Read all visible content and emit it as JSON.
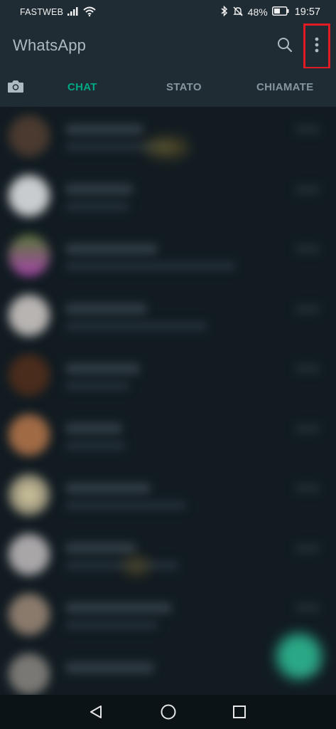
{
  "status_bar": {
    "carrier": "FASTWEB",
    "battery_percent": "48%",
    "time": "19:57",
    "icons": [
      "signal-icon",
      "wifi-icon",
      "bluetooth-icon",
      "mute-icon",
      "battery-icon"
    ]
  },
  "app_bar": {
    "title": "WhatsApp",
    "search_icon": "search-icon",
    "menu_icon": "more-vertical-icon",
    "highlight_color": "#e01b24"
  },
  "tabs": {
    "camera_icon": "camera-icon",
    "items": [
      {
        "label": "CHAT",
        "active": true
      },
      {
        "label": "STATO",
        "active": false
      },
      {
        "label": "CHIAMATE",
        "active": false
      }
    ],
    "active_color": "#00a884"
  },
  "chat_list": {
    "blurred": true,
    "row_count": 10
  },
  "fab": {
    "color": "#2fc197"
  },
  "nav_bar": {
    "icons": [
      "back-icon",
      "home-icon",
      "recent-apps-icon"
    ]
  }
}
